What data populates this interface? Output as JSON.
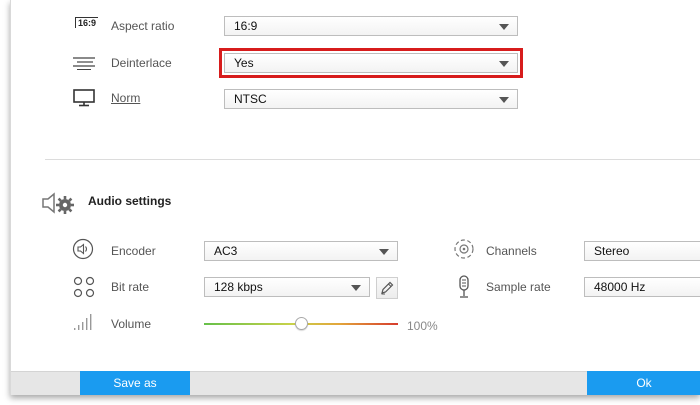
{
  "video": {
    "aspect_ratio": {
      "label": "Aspect ratio",
      "icon_text": "16:9",
      "value": "16:9"
    },
    "deinterlace": {
      "label": "Deinterlace",
      "value": "Yes"
    },
    "norm": {
      "label": "Norm",
      "value": "NTSC"
    }
  },
  "audio": {
    "title": "Audio settings",
    "encoder": {
      "label": "Encoder",
      "value": "AC3"
    },
    "bit_rate": {
      "label": "Bit rate",
      "value": "128 kbps"
    },
    "volume": {
      "label": "Volume",
      "value_text": "100%",
      "level_fraction": 0.5
    },
    "channels": {
      "label": "Channels",
      "value": "Stereo"
    },
    "sample_rate": {
      "label": "Sample rate",
      "value": "48000 Hz"
    }
  },
  "footer": {
    "save_as_label": "Save as",
    "ok_label": "Ok"
  },
  "colors": {
    "accent": "#1a9bf0",
    "highlight": "#d71c1c"
  }
}
